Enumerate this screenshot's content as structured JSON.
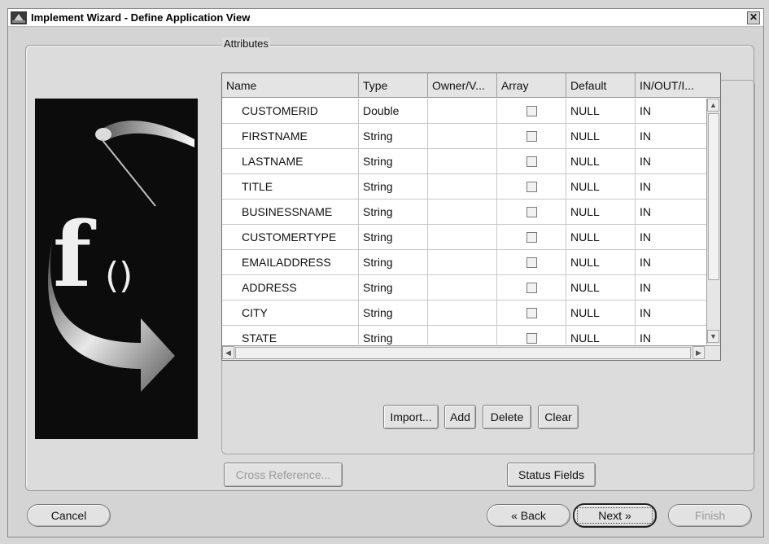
{
  "window": {
    "title": "Implement Wizard - Define Application View",
    "close_glyph": "✕"
  },
  "attributes": {
    "group_label": "Attributes",
    "columns": [
      "Name",
      "Type",
      "Owner/V...",
      "Array",
      "Default",
      "IN/OUT/I..."
    ],
    "rows": [
      {
        "name": "CUSTOMERID",
        "type": "Double",
        "owner": "",
        "array": false,
        "default": "NULL",
        "io": "IN"
      },
      {
        "name": "FIRSTNAME",
        "type": "String",
        "owner": "",
        "array": false,
        "default": "NULL",
        "io": "IN"
      },
      {
        "name": "LASTNAME",
        "type": "String",
        "owner": "",
        "array": false,
        "default": "NULL",
        "io": "IN"
      },
      {
        "name": "TITLE",
        "type": "String",
        "owner": "",
        "array": false,
        "default": "NULL",
        "io": "IN"
      },
      {
        "name": "BUSINESSNAME",
        "type": "String",
        "owner": "",
        "array": false,
        "default": "NULL",
        "io": "IN"
      },
      {
        "name": "CUSTOMERTYPE",
        "type": "String",
        "owner": "",
        "array": false,
        "default": "NULL",
        "io": "IN"
      },
      {
        "name": "EMAILADDRESS",
        "type": "String",
        "owner": "",
        "array": false,
        "default": "NULL",
        "io": "IN"
      },
      {
        "name": "ADDRESS",
        "type": "String",
        "owner": "",
        "array": false,
        "default": "NULL",
        "io": "IN"
      },
      {
        "name": "CITY",
        "type": "String",
        "owner": "",
        "array": false,
        "default": "NULL",
        "io": "IN"
      },
      {
        "name": "STATE",
        "type": "String",
        "owner": "",
        "array": false,
        "default": "NULL",
        "io": "IN"
      }
    ],
    "buttons": {
      "import": "Import...",
      "add": "Add",
      "delete": "Delete",
      "clear": "Clear"
    }
  },
  "panel_buttons": {
    "cross_reference": "Cross Reference...",
    "status_fields": "Status Fields"
  },
  "nav": {
    "cancel": "Cancel",
    "back": "« Back",
    "next": "Next »",
    "finish": "Finish"
  },
  "colors": {
    "window_bg": "#d4d4d4",
    "image_bg": "#0c0c0c",
    "title_bg": "#ffffff"
  },
  "icons": {
    "app": "wizard-app-icon",
    "close": "close-icon",
    "image": "function-arrow-graphic"
  }
}
